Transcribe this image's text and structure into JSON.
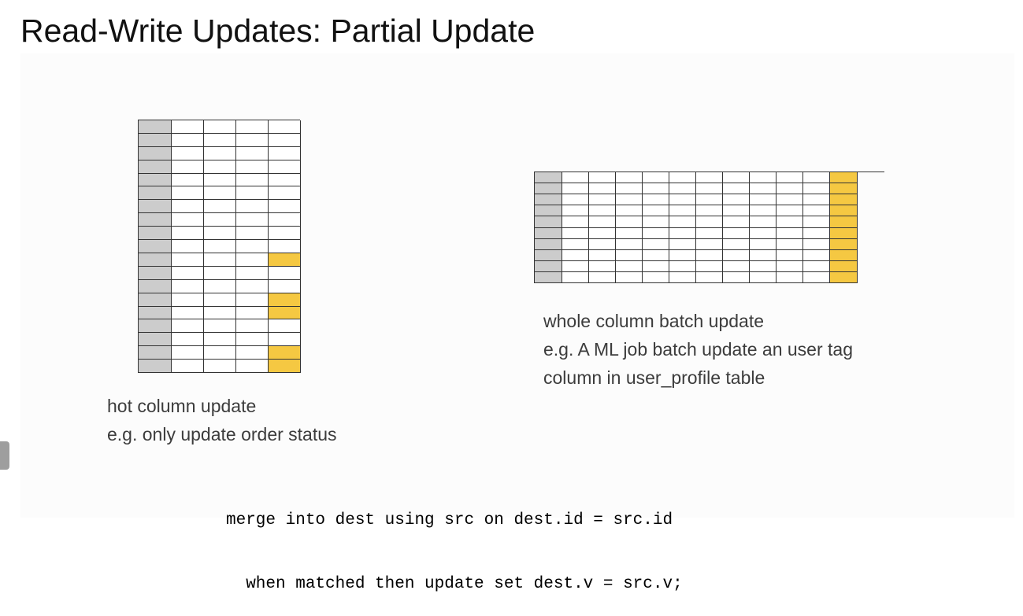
{
  "slide": {
    "title": "Read-Write Updates: Partial Update"
  },
  "colors": {
    "key_column": "#cccccc",
    "updated_cell": "#f5c842",
    "grid_line": "#333333"
  },
  "hot_column_table": {
    "rows": 19,
    "columns": 5,
    "key_column": 0,
    "updated_column": 4,
    "updated_rows": [
      10,
      13,
      14,
      17,
      18
    ],
    "caption_lines": [
      "hot column update",
      "e.g. only update order status"
    ]
  },
  "whole_column_table": {
    "rows": 10,
    "columns": 12,
    "key_column": 0,
    "updated_column": 11,
    "caption_lines": [
      "whole column batch update",
      "e.g. A ML job batch update an user tag",
      "column in user_profile table"
    ]
  },
  "sql_example": {
    "lines": [
      "merge into dest using src on dest.id = src.id",
      "  when matched then update set dest.v = src.v;"
    ]
  }
}
